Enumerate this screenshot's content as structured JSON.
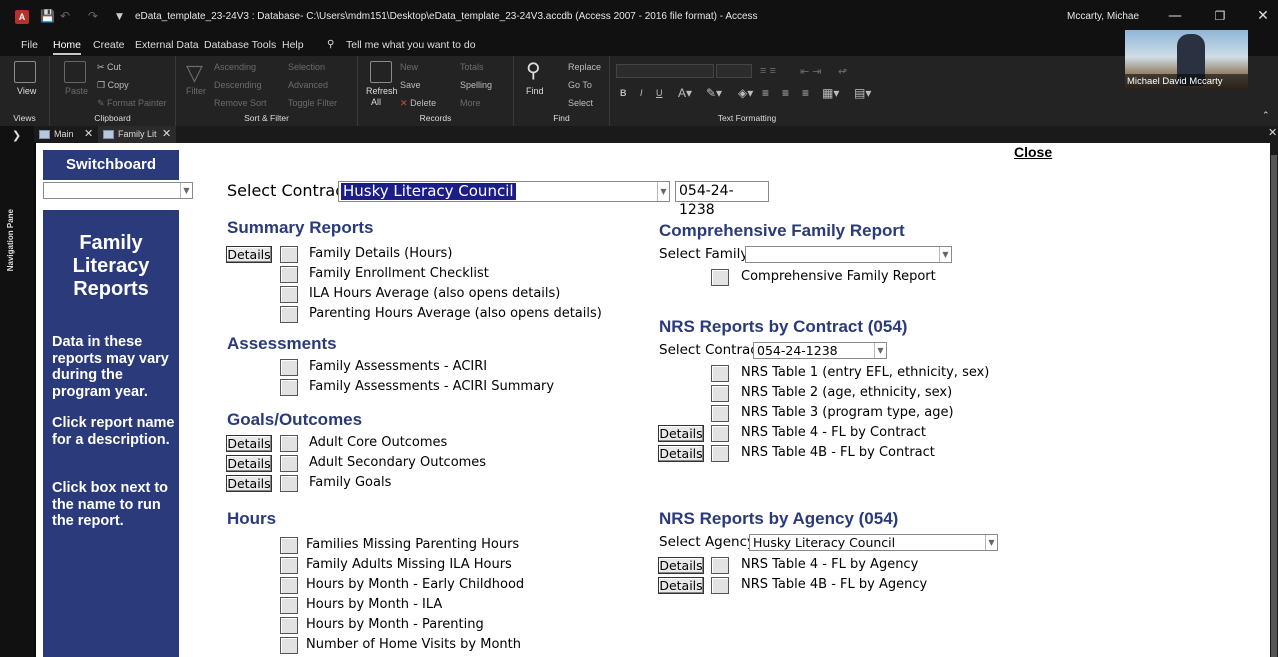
{
  "window": {
    "title": "eData_template_23-24V3 : Database- C:\\Users\\mdm151\\Desktop\\eData_template_23-24V3.accdb (Access 2007 - 2016 file format)  -  Access",
    "user": "Mccarty, Michae",
    "app_letter": "A"
  },
  "menu": {
    "items": [
      "File",
      "Home",
      "Create",
      "External Data",
      "Database Tools",
      "Help"
    ],
    "search": "Tell me what you want to do"
  },
  "ribbon": {
    "views": {
      "view": "View",
      "label": "Views"
    },
    "clipboard": {
      "paste": "Paste",
      "cut": "Cut",
      "copy": "Copy",
      "format_painter": "Format Painter",
      "label": "Clipboard"
    },
    "sort_filter": {
      "filter": "Filter",
      "ascending": "Ascending",
      "descending": "Descending",
      "remove_sort": "Remove Sort",
      "selection": "Selection",
      "advanced": "Advanced",
      "toggle_filter": "Toggle Filter",
      "label": "Sort & Filter"
    },
    "records": {
      "refresh": "Refresh",
      "refresh_all": "All",
      "new": "New",
      "save": "Save",
      "delete": "Delete",
      "totals": "Totals",
      "spelling": "Spelling",
      "more": "More",
      "label": "Records"
    },
    "find": {
      "find": "Find",
      "replace": "Replace",
      "goto": "Go To",
      "select": "Select",
      "label": "Find"
    },
    "text_formatting": {
      "label": "Text Formatting",
      "bold": "B",
      "italic": "I",
      "underline": "U"
    }
  },
  "webcam": {
    "name": "Michael David Mccarty"
  },
  "nav_pane": {
    "label": "Navigation Pane"
  },
  "tabs": [
    {
      "label": "Main"
    },
    {
      "label": "Family Lit"
    }
  ],
  "form": {
    "close": "Close",
    "switchboard": {
      "title": "Switchboard",
      "heading": "Family Literacy Reports",
      "para1": "Data in these reports may vary during the program year.",
      "para2": "Click report name for a description.",
      "para3": "Click box next to the name to run the report."
    },
    "select_contract": {
      "label": "Select Contract:",
      "value": "Husky Literacy Council",
      "number": "054-24-1238"
    },
    "details_label": "Details",
    "summary": {
      "title": "Summary Reports",
      "items": [
        "Family Details (Hours)",
        "Family Enrollment Checklist",
        "ILA Hours Average (also opens details)",
        "Parenting Hours Average (also opens details)"
      ]
    },
    "assessments": {
      "title": "Assessments",
      "items": [
        "Family Assessments - ACIRI",
        "Family Assessments - ACIRI Summary"
      ]
    },
    "goals": {
      "title": "Goals/Outcomes",
      "items": [
        "Adult Core Outcomes",
        "Adult Secondary Outcomes",
        "Family Goals"
      ]
    },
    "hours": {
      "title": "Hours",
      "items": [
        "Families Missing Parenting Hours",
        "Family Adults Missing ILA Hours",
        "Hours by Month - Early Childhood",
        "Hours by Month - ILA",
        "Hours by Month - Parenting",
        "Number of Home Visits by Month"
      ]
    },
    "comprehensive": {
      "title": "Comprehensive Family Report",
      "select_label": "Select Family:",
      "select_value": "",
      "item": "Comprehensive Family Report"
    },
    "nrs_contract": {
      "title": "NRS Reports by Contract (054)",
      "select_label": "Select Contract:",
      "select_value": "054-24-1238",
      "items": [
        "NRS Table 1 (entry EFL, ethnicity, sex)",
        "NRS Table 2 (age, ethnicity, sex)",
        "NRS Table 3 (program type, age)",
        "NRS Table 4 - FL by Contract",
        "NRS Table 4B - FL by Contract"
      ]
    },
    "nrs_agency": {
      "title": "NRS Reports by Agency (054)",
      "select_label": "Select Agency:",
      "select_value": "Husky Literacy Council",
      "items": [
        "NRS Table 4 - FL by Agency",
        "NRS Table 4B - FL by Agency"
      ]
    }
  }
}
